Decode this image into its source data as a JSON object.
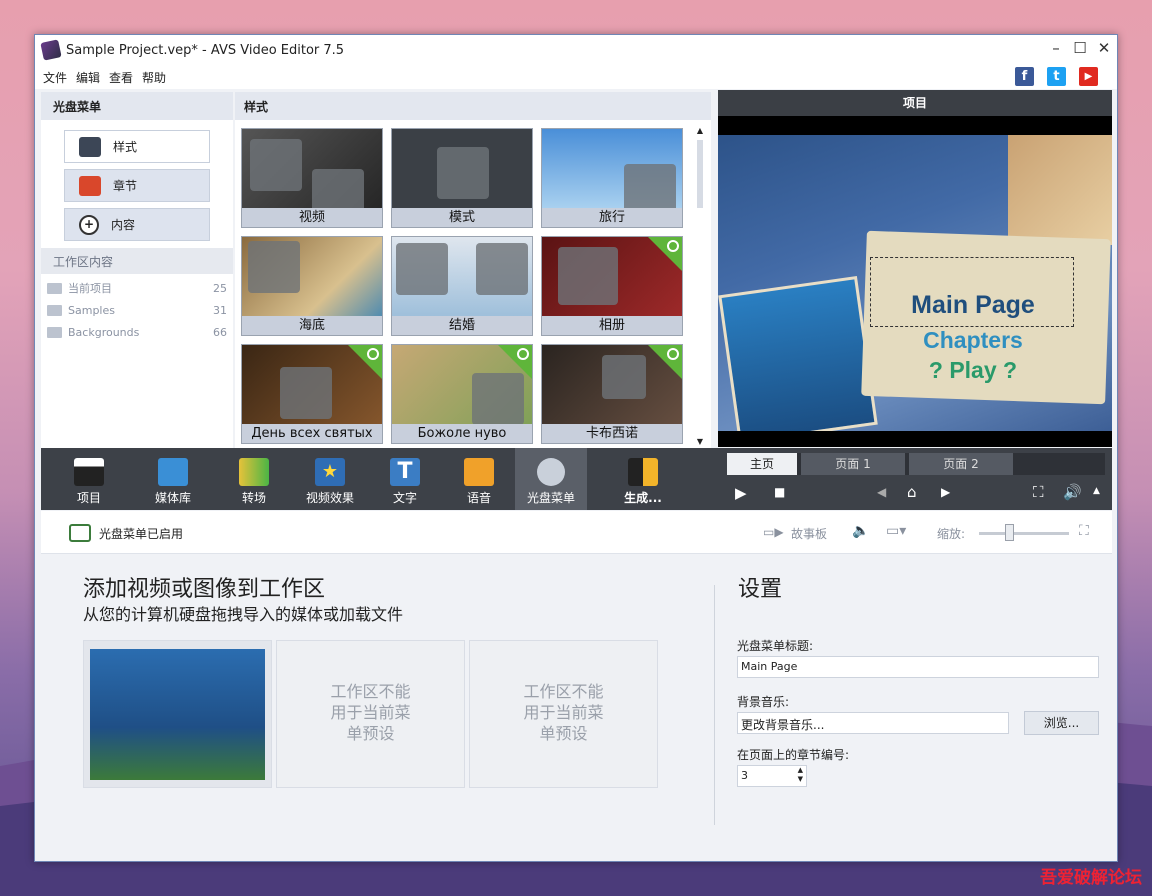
{
  "window": {
    "title": "Sample Project.vep* - AVS Video Editor 7.5"
  },
  "menu": [
    "文件",
    "编辑",
    "查看",
    "帮助"
  ],
  "social": [
    {
      "name": "facebook-icon",
      "glyph": "f",
      "color": "#3b5998"
    },
    {
      "name": "twitter-icon",
      "glyph": "t",
      "color": "#1da1f2"
    },
    {
      "name": "youtube-icon",
      "glyph": "▶",
      "color": "#e02a20"
    }
  ],
  "left_panel": {
    "header": "光盘菜单",
    "buttons": [
      {
        "label": "样式",
        "active": true
      },
      {
        "label": "章节",
        "active": false
      },
      {
        "label": "内容",
        "active": false
      }
    ],
    "workspace_header": "工作区内容",
    "workspace_items": [
      {
        "label": "当前项目",
        "count": "25"
      },
      {
        "label": "Samples",
        "count": "31"
      },
      {
        "label": "Backgrounds",
        "count": "66"
      }
    ]
  },
  "styles_panel": {
    "header": "样式",
    "tiles": [
      "视频",
      "模式",
      "旅行",
      "海底",
      "结婚",
      "相册",
      "День всех святых",
      "Божоле нуво",
      "卡布西诺"
    ]
  },
  "preview": {
    "header": "项目",
    "menu_title": "Main Page",
    "menu_items": [
      "Chapters",
      "? Play ?"
    ]
  },
  "toolbar": {
    "items": [
      "项目",
      "媒体库",
      "转场",
      "视频效果",
      "文字",
      "语音",
      "光盘菜单",
      "生成..."
    ],
    "page_tabs": [
      "主页",
      "页面 1",
      "页面 2"
    ]
  },
  "status": {
    "enabled_label": "光盘菜单已启用",
    "storyboard": "故事板",
    "zoom": "缩放:"
  },
  "workspace": {
    "title": "添加视频或图像到工作区",
    "subtitle": "从您的计算机硬盘拖拽导入的媒体或加载文件",
    "disabled_text": "工作区不能用于当前菜单预设"
  },
  "settings": {
    "title": "设置",
    "menu_title_label": "光盘菜单标题:",
    "menu_title_value": "Main Page",
    "music_label": "背景音乐:",
    "music_value": "更改背景音乐...",
    "browse": "浏览...",
    "chapters_label": "在页面上的章节编号:",
    "chapters_value": "3"
  },
  "watermark": "吾爱破解论坛"
}
